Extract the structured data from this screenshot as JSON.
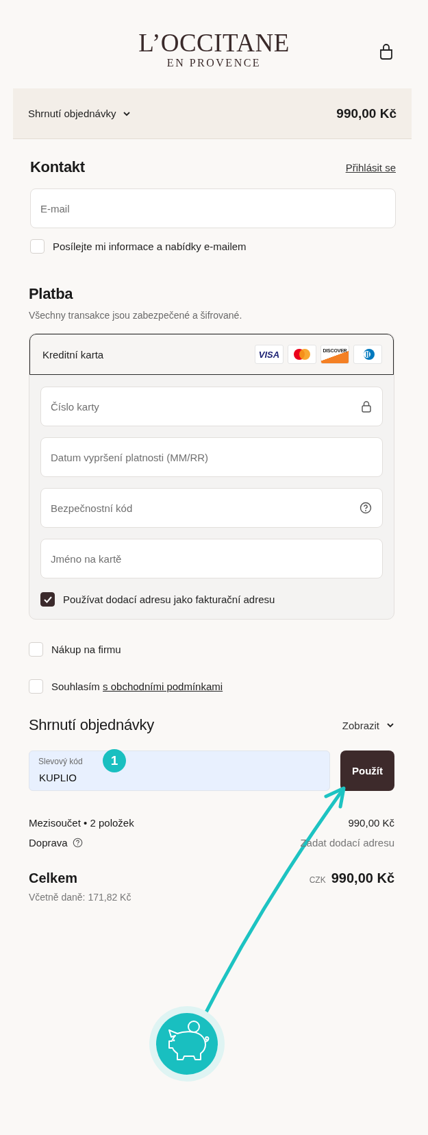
{
  "header": {
    "brand": "L’OCCITANE",
    "brand_sub": "EN PROVENCE"
  },
  "summary_bar": {
    "label": "Shrnutí objednávky",
    "expanded": false,
    "total": "990,00 Kč"
  },
  "contact": {
    "title": "Kontakt",
    "login_link": "Přihlásit se",
    "email": {
      "placeholder": "E-mail"
    },
    "newsletter": {
      "label": "Posílejte mi informace a nabídky e-mailem",
      "checked": false
    }
  },
  "payment": {
    "title": "Platba",
    "subtitle": "Všechny transakce jsou zabezpečené a šifrované.",
    "method": {
      "label": "Kreditní karta",
      "selected": true
    },
    "card_logos": [
      {
        "kind": "visa",
        "text": "VISA"
      },
      {
        "kind": "mastercard"
      },
      {
        "kind": "discover",
        "text": "DISCOVER"
      },
      {
        "kind": "diners"
      }
    ],
    "fields": [
      {
        "placeholder": "Číslo karty",
        "kind": "lock"
      },
      {
        "placeholder": "Datum vypršení platnosti (MM/RR)",
        "kind": "plain"
      },
      {
        "placeholder": "Bezpečnostní kód",
        "kind": "help"
      },
      {
        "placeholder": "Jméno na kartě",
        "kind": "plain"
      }
    ],
    "billing_same": {
      "label": "Používat dodací adresu jako fakturační adresu",
      "checked": true
    }
  },
  "options": [
    {
      "label": "Nákup na firmu",
      "checked": false
    },
    {
      "label": "Souhlasím",
      "link": "s obchodními podmínkami",
      "checked": false
    }
  ],
  "order_summary": {
    "title": "Shrnutí objednávky",
    "toggle": "Zobrazit",
    "expanded": false,
    "discount": {
      "label": "Slevový kód",
      "value": "KUPLIO"
    },
    "apply": "Použít",
    "lines": [
      {
        "label": "Mezisoučet • 2 položek",
        "value": "990,00 Kč",
        "kind": "plain"
      },
      {
        "label": "Doprava",
        "value": "Zadat dodací adresu",
        "kind": "help"
      }
    ],
    "total": {
      "label": "Celkem",
      "currency": "CZK",
      "value": "990,00 Kč",
      "tax_note": "Včetně daně: 171,82 Kč"
    }
  },
  "annotation": {
    "step": "1"
  }
}
